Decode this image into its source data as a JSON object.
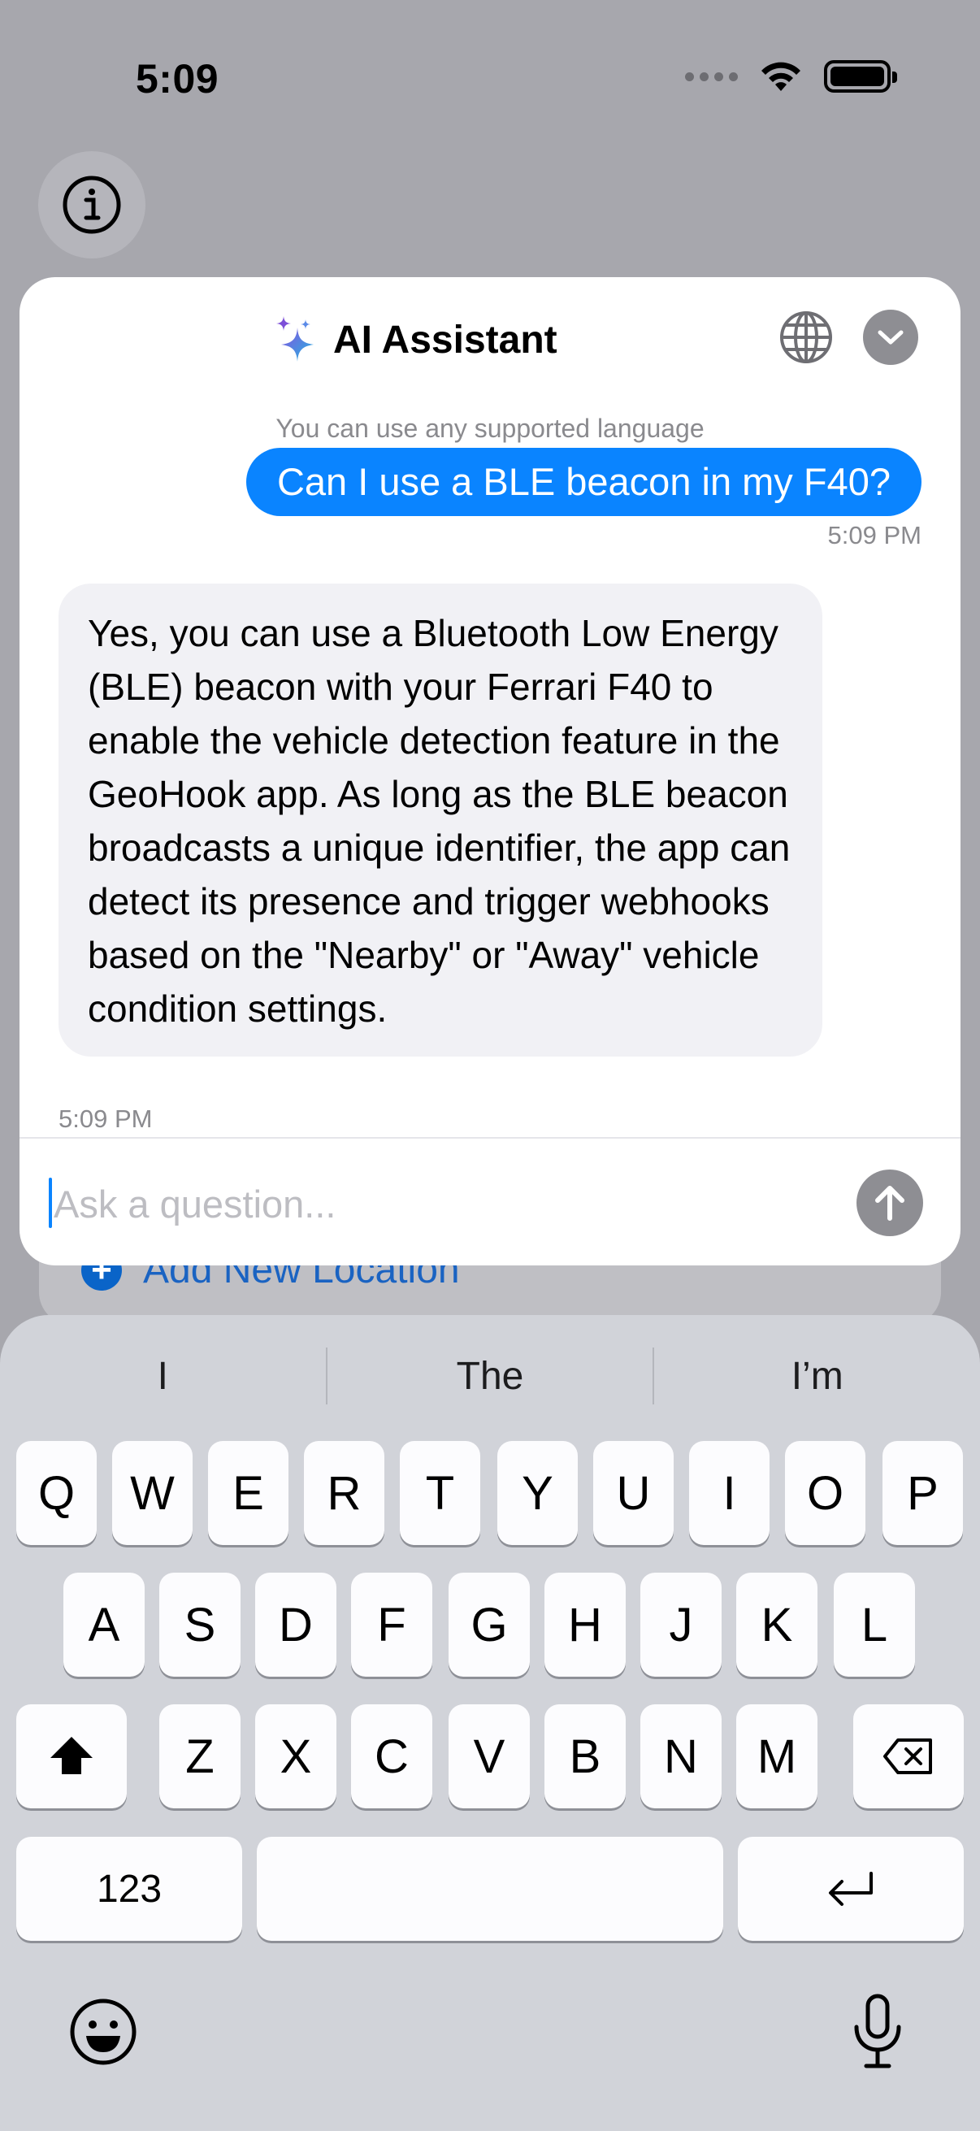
{
  "status_bar": {
    "time": "5:09"
  },
  "background": {
    "add_location_label": "Add New Location"
  },
  "sheet": {
    "title": "AI Assistant",
    "hint": "You can use any supported language",
    "messages": [
      {
        "role": "user",
        "text": "Can I use a BLE beacon in my F40?",
        "time": "5:09 PM"
      },
      {
        "role": "assistant",
        "text": "Yes, you can use a Bluetooth Low Energy (BLE) beacon with your Ferrari F40 to enable the vehicle detection feature in the GeoHook app. As long as the BLE beacon broadcasts a unique identifier, the app can detect its presence and trigger webhooks based on the \"Nearby\" or \"Away\" vehicle condition settings.",
        "time": "5:09 PM"
      }
    ],
    "input": {
      "placeholder": "Ask a question...",
      "value": ""
    }
  },
  "keyboard": {
    "suggestions": [
      "I",
      "The",
      "I’m"
    ],
    "row1": [
      "Q",
      "W",
      "E",
      "R",
      "T",
      "Y",
      "U",
      "I",
      "O",
      "P"
    ],
    "row2": [
      "A",
      "S",
      "D",
      "F",
      "G",
      "H",
      "J",
      "K",
      "L"
    ],
    "row3": [
      "Z",
      "X",
      "C",
      "V",
      "B",
      "N",
      "M"
    ],
    "numbers_key": "123"
  },
  "colors": {
    "accent": "#0a84ff",
    "assistant_bubble": "#f1f1f5",
    "send_disabled": "#8e8e93"
  },
  "icons": [
    "info-icon",
    "sparkles-icon",
    "globe-icon",
    "chevron-down-icon",
    "arrow-up-icon",
    "shift-icon",
    "delete-icon",
    "return-icon",
    "emoji-icon",
    "microphone-icon",
    "plus-icon"
  ]
}
